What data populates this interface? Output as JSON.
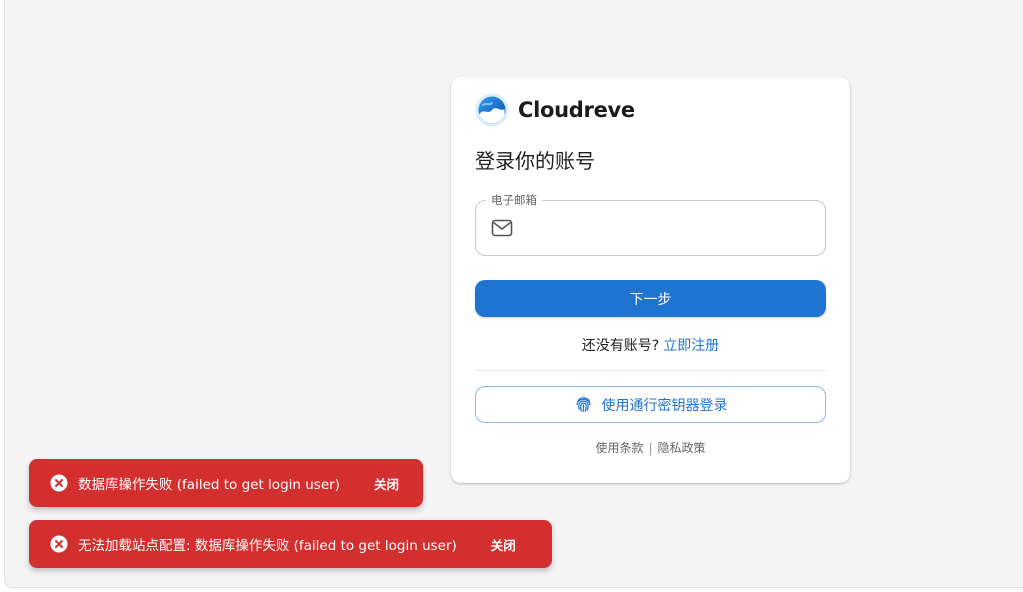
{
  "app": {
    "brand": "Cloudreve",
    "accent_color": "#1f74d2",
    "error_color": "#d32f2f"
  },
  "login": {
    "title": "登录你的账号",
    "email_label": "电子邮箱",
    "email_value": "",
    "email_icon": "mail-icon",
    "next_label": "下一步",
    "no_account_text": "还没有账号?",
    "signup_link": "立即注册",
    "passkey_label": "使用通行密钥器登录",
    "passkey_icon": "fingerprint-icon",
    "terms_link": "使用条款",
    "separator": "|",
    "privacy_link": "隐私政策"
  },
  "toasts": [
    {
      "icon": "error-icon",
      "message": "数据库操作失败 (failed to get login user)",
      "close_label": "关闭"
    },
    {
      "icon": "error-icon",
      "message": "无法加载站点配置: 数据库操作失败 (failed to get login user)",
      "close_label": "关闭"
    }
  ]
}
